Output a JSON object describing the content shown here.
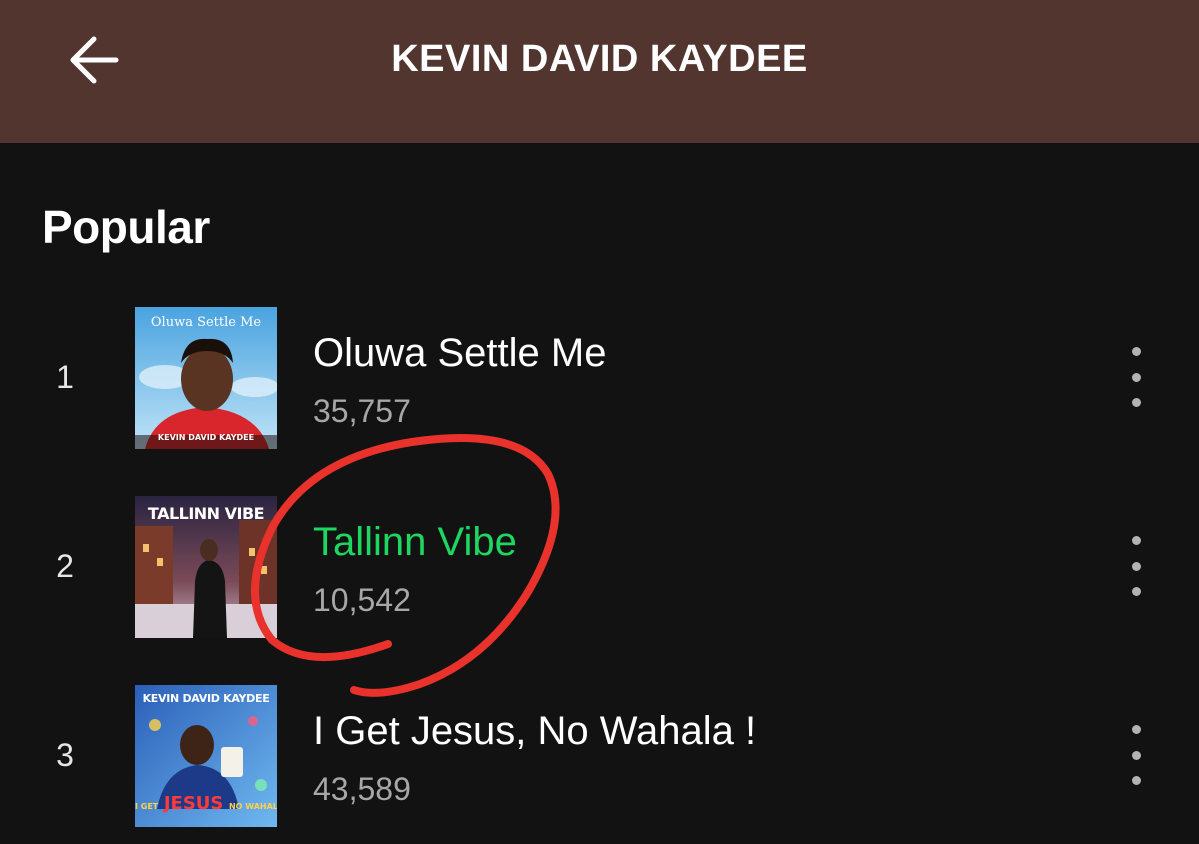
{
  "header": {
    "title": "KEVIN DAVID KAYDEE",
    "background": "#52352f"
  },
  "section": {
    "title": "Popular"
  },
  "tracks": [
    {
      "number": "1",
      "title": "Oluwa Settle Me",
      "plays": "35,757",
      "active": false,
      "cover": {
        "title": "Oluwa Settle Me",
        "artist": "KEVIN DAVID KAYDEE"
      }
    },
    {
      "number": "2",
      "title": "Tallinn Vibe",
      "plays": "10,542",
      "active": true,
      "cover": {
        "title": "TALLINN VIBE"
      }
    },
    {
      "number": "3",
      "title": "I Get Jesus, No Wahala !",
      "plays": "43,589",
      "active": false,
      "cover": {
        "artist": "KEVIN DAVID KAYDEE",
        "title_left": "I GET",
        "title_main": "JESUS",
        "title_right": "NO WAHALA !!!"
      }
    }
  ],
  "icons": {
    "back": "arrow-left-icon",
    "more": "more-vertical-icon"
  },
  "colors": {
    "active_track": "#1ed760",
    "annotation_circle": "#e8322b",
    "background": "#121212"
  }
}
